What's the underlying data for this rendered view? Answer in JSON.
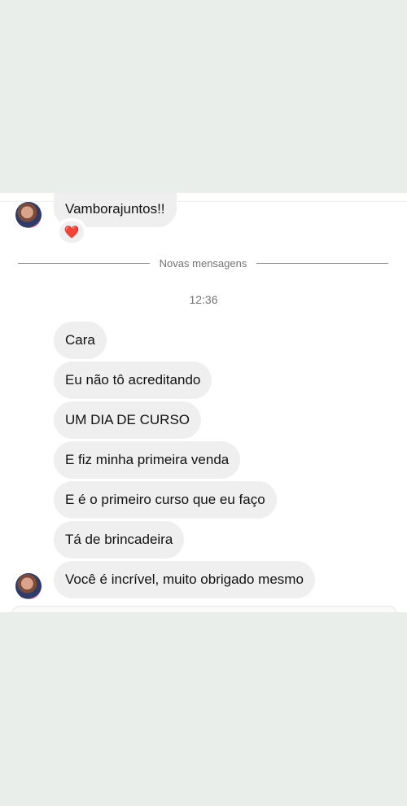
{
  "conversation": {
    "previous_message": "Vamborajuntos!!",
    "reaction": "❤️",
    "new_messages_label": "Novas mensagens",
    "timestamp": "12:36",
    "messages": [
      "Cara",
      "Eu não tô acreditando",
      "UM DIA DE CURSO",
      "E fiz minha primeira venda",
      "E é o primeiro curso que eu faço",
      "Tá de brincadeira",
      "Você é incrível, muito obrigado mesmo"
    ]
  }
}
